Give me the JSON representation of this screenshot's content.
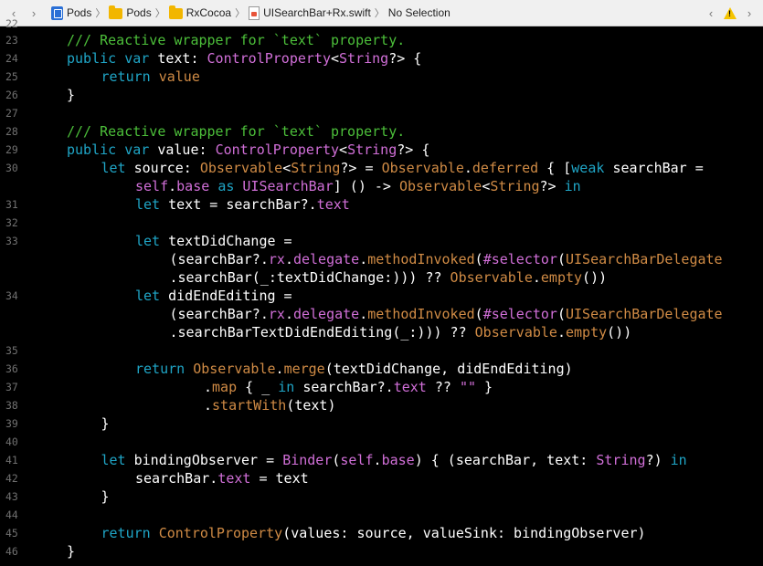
{
  "jumpbar": {
    "back_label": "‹",
    "forward_label": "›",
    "crumbs": [
      "Pods",
      "Pods",
      "RxCocoa",
      "UISearchBar+Rx.swift",
      "No Selection"
    ],
    "issue_prev": "‹",
    "issue_next": "›",
    "warning_glyph": "!"
  },
  "colors": {
    "comment": "#4cbf3a",
    "keyword": "#1fa5c6",
    "type": "#d16fd8",
    "member": "#d08b45",
    "plain": "#ffffff",
    "background": "#000000"
  },
  "editor": {
    "top_partial_line_number": "22",
    "lines": [
      {
        "n": "23",
        "indent": 1,
        "segments": [
          [
            "c",
            "/// Reactive wrapper for `text` property."
          ]
        ]
      },
      {
        "n": "24",
        "indent": 1,
        "segments": [
          [
            "k",
            "public var "
          ],
          [
            "p",
            "text: "
          ],
          [
            "t",
            "ControlProperty"
          ],
          [
            "p",
            "<"
          ],
          [
            "t",
            "String"
          ],
          [
            "p",
            "?> {"
          ]
        ]
      },
      {
        "n": "25",
        "indent": 2,
        "segments": [
          [
            "k",
            "return "
          ],
          [
            "o",
            "value"
          ]
        ]
      },
      {
        "n": "26",
        "indent": 1,
        "segments": [
          [
            "p",
            "}"
          ]
        ]
      },
      {
        "n": "27",
        "indent": 0,
        "segments": []
      },
      {
        "n": "28",
        "indent": 1,
        "segments": [
          [
            "c",
            "/// Reactive wrapper for `text` property."
          ]
        ]
      },
      {
        "n": "29",
        "indent": 1,
        "segments": [
          [
            "k",
            "public var "
          ],
          [
            "p",
            "value: "
          ],
          [
            "t",
            "ControlProperty"
          ],
          [
            "p",
            "<"
          ],
          [
            "t",
            "String"
          ],
          [
            "p",
            "?> {"
          ]
        ]
      },
      {
        "n": "30",
        "indent": 2,
        "segments": [
          [
            "k",
            "let "
          ],
          [
            "p",
            "source: "
          ],
          [
            "o",
            "Observable"
          ],
          [
            "p",
            "<"
          ],
          [
            "o",
            "String"
          ],
          [
            "p",
            "?> = "
          ],
          [
            "o",
            "Observable"
          ],
          [
            "p",
            "."
          ],
          [
            "o",
            "deferred"
          ],
          [
            "p",
            " { ["
          ],
          [
            "k",
            "weak "
          ],
          [
            "p",
            "searchBar ="
          ]
        ]
      },
      {
        "n": "",
        "indent": 3,
        "segments": [
          [
            "t",
            "self"
          ],
          [
            "p",
            "."
          ],
          [
            "t",
            "base "
          ],
          [
            "k",
            "as "
          ],
          [
            "t",
            "UISearchBar"
          ],
          [
            "p",
            "] () -> "
          ],
          [
            "o",
            "Observable"
          ],
          [
            "p",
            "<"
          ],
          [
            "o",
            "String"
          ],
          [
            "p",
            "?> "
          ],
          [
            "k",
            "in"
          ]
        ]
      },
      {
        "n": "31",
        "indent": 3,
        "segments": [
          [
            "k",
            "let "
          ],
          [
            "p",
            "text = searchBar?."
          ],
          [
            "t",
            "text"
          ]
        ]
      },
      {
        "n": "32",
        "indent": 0,
        "segments": []
      },
      {
        "n": "33",
        "indent": 3,
        "segments": [
          [
            "k",
            "let "
          ],
          [
            "p",
            "textDidChange ="
          ]
        ]
      },
      {
        "n": "",
        "indent": 4,
        "segments": [
          [
            "p",
            "(searchBar?."
          ],
          [
            "t",
            "rx"
          ],
          [
            "p",
            "."
          ],
          [
            "t",
            "delegate"
          ],
          [
            "p",
            "."
          ],
          [
            "o",
            "methodInvoked"
          ],
          [
            "p",
            "("
          ],
          [
            "t",
            "#selector"
          ],
          [
            "p",
            "("
          ],
          [
            "o",
            "UISearchBarDelegate"
          ]
        ]
      },
      {
        "n": "",
        "indent": 4,
        "segments": [
          [
            "p",
            "."
          ],
          [
            "p",
            "searchBar(_:textDidChange:))) ?? "
          ],
          [
            "o",
            "Observable"
          ],
          [
            "p",
            "."
          ],
          [
            "o",
            "empty"
          ],
          [
            "p",
            "())"
          ]
        ]
      },
      {
        "n": "34",
        "indent": 3,
        "segments": [
          [
            "k",
            "let "
          ],
          [
            "p",
            "didEndEditing ="
          ]
        ]
      },
      {
        "n": "",
        "indent": 4,
        "segments": [
          [
            "p",
            "(searchBar?."
          ],
          [
            "t",
            "rx"
          ],
          [
            "p",
            "."
          ],
          [
            "t",
            "delegate"
          ],
          [
            "p",
            "."
          ],
          [
            "o",
            "methodInvoked"
          ],
          [
            "p",
            "("
          ],
          [
            "t",
            "#selector"
          ],
          [
            "p",
            "("
          ],
          [
            "o",
            "UISearchBarDelegate"
          ]
        ]
      },
      {
        "n": "",
        "indent": 4,
        "segments": [
          [
            "p",
            ".searchBarTextDidEndEditing(_:))) ?? "
          ],
          [
            "o",
            "Observable"
          ],
          [
            "p",
            "."
          ],
          [
            "o",
            "empty"
          ],
          [
            "p",
            "())"
          ]
        ]
      },
      {
        "n": "35",
        "indent": 0,
        "segments": []
      },
      {
        "n": "36",
        "indent": 3,
        "segments": [
          [
            "k",
            "return "
          ],
          [
            "o",
            "Observable"
          ],
          [
            "p",
            "."
          ],
          [
            "o",
            "merge"
          ],
          [
            "p",
            "(textDidChange, didEndEditing)"
          ]
        ]
      },
      {
        "n": "37",
        "indent": 5,
        "segments": [
          [
            "p",
            "."
          ],
          [
            "o",
            "map"
          ],
          [
            "p",
            " { _ "
          ],
          [
            "k",
            "in "
          ],
          [
            "p",
            "searchBar?."
          ],
          [
            "t",
            "text"
          ],
          [
            "p",
            " ?? "
          ],
          [
            "t",
            "\"\""
          ],
          [
            "p",
            " }"
          ]
        ]
      },
      {
        "n": "38",
        "indent": 5,
        "segments": [
          [
            "p",
            "."
          ],
          [
            "o",
            "startWith"
          ],
          [
            "p",
            "(text)"
          ]
        ]
      },
      {
        "n": "39",
        "indent": 2,
        "segments": [
          [
            "p",
            "}"
          ]
        ]
      },
      {
        "n": "40",
        "indent": 0,
        "segments": []
      },
      {
        "n": "41",
        "indent": 2,
        "segments": [
          [
            "k",
            "let "
          ],
          [
            "p",
            "bindingObserver = "
          ],
          [
            "t",
            "Binder"
          ],
          [
            "p",
            "("
          ],
          [
            "t",
            "self"
          ],
          [
            "p",
            "."
          ],
          [
            "t",
            "base"
          ],
          [
            "p",
            ") { (searchBar, text: "
          ],
          [
            "t",
            "String"
          ],
          [
            "p",
            "?) "
          ],
          [
            "k",
            "in"
          ]
        ]
      },
      {
        "n": "42",
        "indent": 3,
        "segments": [
          [
            "p",
            "searchBar."
          ],
          [
            "t",
            "text"
          ],
          [
            "p",
            " = text"
          ]
        ]
      },
      {
        "n": "43",
        "indent": 2,
        "segments": [
          [
            "p",
            "}"
          ]
        ]
      },
      {
        "n": "44",
        "indent": 0,
        "segments": []
      },
      {
        "n": "45",
        "indent": 2,
        "segments": [
          [
            "k",
            "return "
          ],
          [
            "o",
            "ControlProperty"
          ],
          [
            "p",
            "(values: source, valueSink: bindingObserver)"
          ]
        ]
      },
      {
        "n": "46",
        "indent": 1,
        "segments": [
          [
            "p",
            "}"
          ]
        ]
      }
    ]
  }
}
